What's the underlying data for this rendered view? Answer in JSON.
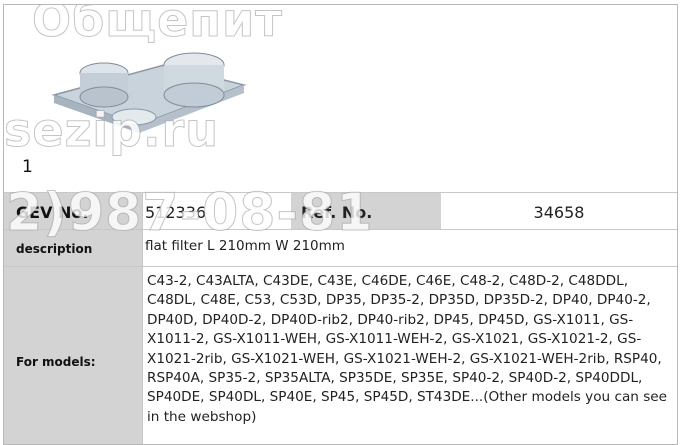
{
  "product": {
    "item_number": "1",
    "part_number_label": "GEV No.",
    "part_number": "512336",
    "ref_label": "Ref. No.",
    "ref_number": "34658",
    "description_label": "description",
    "description": "flat filter L 210mm W 210mm",
    "models_label": "For models:",
    "models": "C43-2, C43ALTA, C43DE, C43E, C46DE, C46E, C48-2, C48D-2, C48DDL, C48DL, C48E, C53, C53D, DP35, DP35-2, DP35D, DP35D-2, DP40, DP40-2, DP40D, DP40D-2, DP40D-rib2, DP40-rib2, DP45, DP45D, GS-X1011, GS-X1011-2, GS-X1011-WEH, GS-X1011-WEH-2, GS-X1021, GS-X1021-2, GS-X1021-2rib, GS-X1021-WEH, GS-X1021-WEH-2, GS-X1021-WEH-2rib, RSP40, RSP40A, SP35-2, SP35ALTA, SP35DE, SP35E, SP40-2, SP40D-2, SP40DDL, SP40DE, SP40DL, SP40E, SP45, SP45D, ST43DE...(Other models you can see in the webshop)"
  },
  "watermark": {
    "line1": "Общепит",
    "line2": "sezip.ru",
    "line3": "2)987-08-81"
  },
  "image": {
    "icon": "flat-filter-product-image"
  }
}
